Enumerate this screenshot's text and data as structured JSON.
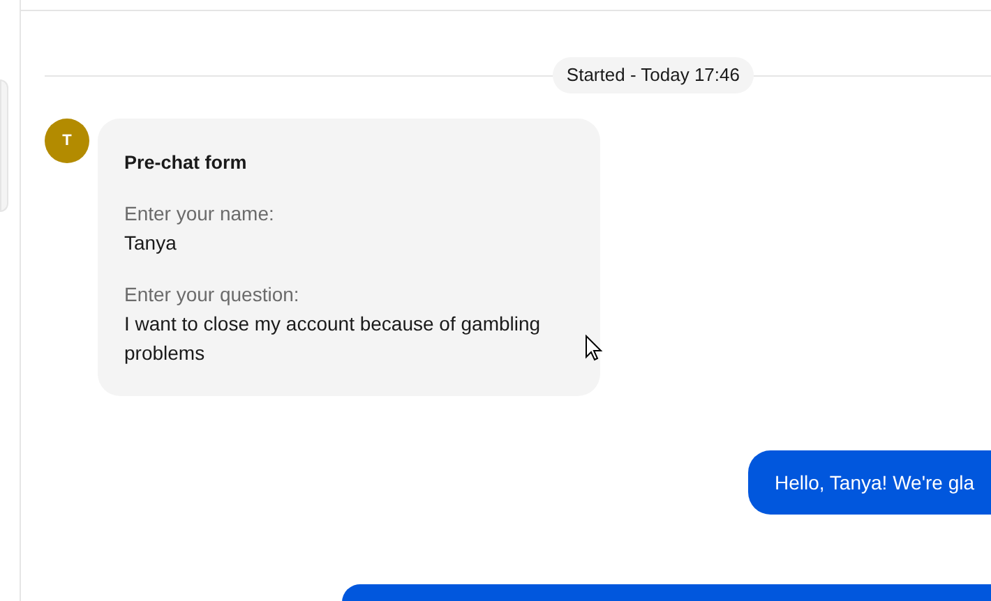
{
  "divider": {
    "label": "Started - Today 17:46"
  },
  "messages": [
    {
      "kind": "form",
      "avatar": "T",
      "color": "#b38b00",
      "title": "Pre-chat form",
      "fields": [
        {
          "label": "Enter your name:",
          "value": "Tanya"
        },
        {
          "label": "Enter your question:",
          "value": "I want to close my account because of gambling problems"
        }
      ]
    },
    {
      "kind": "agent",
      "text": "Hello, Tanya! We're gla"
    },
    {
      "kind": "agent"
    }
  ]
}
